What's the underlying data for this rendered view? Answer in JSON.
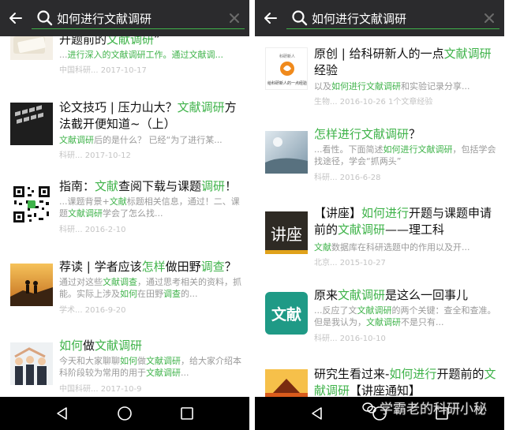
{
  "left": {
    "search": {
      "query": "如何进行文献调研"
    },
    "items": [
      {
        "title_parts": [
          [
            "开题前的",
            0
          ],
          [
            "文献调研",
            1
          ],
          [
            "”",
            0
          ]
        ],
        "snippet_parts": [
          [
            "...",
            0
          ],
          [
            "进行深入的文献调研工作。通过文献调...",
            1
          ]
        ],
        "meta": "中国科研...  2017-10-17"
      },
      {
        "title_parts": [
          [
            "论文技巧 | 压力山大？",
            0
          ],
          [
            "文献调研",
            1
          ],
          [
            "方法截开便知道~（上）",
            0
          ]
        ],
        "snippet_parts": [
          [
            "文献调研",
            1
          ],
          [
            "后的是什么？ 已经“为了进行某...",
            0
          ]
        ],
        "meta": "科研... 2017-10-12"
      },
      {
        "title_parts": [
          [
            "指南：",
            0
          ],
          [
            "文献",
            1
          ],
          [
            "查阅下载与课题",
            0
          ],
          [
            "调研",
            1
          ],
          [
            "！",
            0
          ]
        ],
        "snippet_parts": [
          [
            "...课题背景+",
            0
          ],
          [
            "文献",
            1
          ],
          [
            "标题相关信息，通过！二、课题",
            0
          ],
          [
            "文献调研",
            1
          ],
          [
            "学会了怎么找...",
            0
          ]
        ],
        "meta": "科研... 2016-2-10"
      },
      {
        "title_parts": [
          [
            "荐读 | 学者应该",
            0
          ],
          [
            "怎样",
            1
          ],
          [
            "做田野",
            0
          ],
          [
            "调查",
            1
          ],
          [
            "？",
            0
          ]
        ],
        "snippet_parts": [
          [
            "通过对这些",
            0
          ],
          [
            "文献调查",
            1
          ],
          [
            "，通过思考相关的资料，抓能。实际上涉及",
            0
          ],
          [
            "如何",
            1
          ],
          [
            "在田野",
            0
          ],
          [
            "调查",
            1
          ],
          [
            "的...",
            0
          ]
        ],
        "meta": "学术... 2016-9-20"
      },
      {
        "title_parts": [
          [
            "如何",
            1
          ],
          [
            "做",
            0
          ],
          [
            "文献调研",
            1
          ]
        ],
        "snippet_parts": [
          [
            "今天和大家聊聊",
            0
          ],
          [
            "如何",
            1
          ],
          [
            "做",
            0
          ],
          [
            "文献调研",
            1
          ],
          [
            "，给大家介绍本科阶段较为常用的用于",
            0
          ],
          [
            "文献调研",
            1
          ],
          [
            "...",
            0
          ]
        ],
        "meta": "中国科研... 2017-10-9"
      }
    ]
  },
  "right": {
    "search": {
      "query": "如何进行文献调研"
    },
    "items": [
      {
        "title_parts": [
          [
            "原创 | 给科研新人的一点",
            0
          ],
          [
            "文献调研",
            1
          ],
          [
            "经验",
            0
          ]
        ],
        "snippet_parts": [
          [
            "以及",
            0
          ],
          [
            "如何进行文献调研",
            1
          ],
          [
            "和实验记录分享...",
            0
          ]
        ],
        "meta": "生物... 2016-10-26    1个文章经验"
      },
      {
        "title_parts": [
          [
            "怎样进行文献调研",
            1
          ],
          [
            "？",
            0
          ]
        ],
        "snippet_parts": [
          [
            "...看性。下面简述",
            0
          ],
          [
            "如何进行文献调研",
            1
          ],
          [
            "，包括学会找途径，学会“抓两头”",
            0
          ]
        ],
        "meta": "科研... 2016-6-28"
      },
      {
        "title_parts": [
          [
            "【讲座】",
            0
          ],
          [
            "如何进行",
            1
          ],
          [
            "开题与课题申请前的",
            0
          ],
          [
            "文献调研",
            1
          ],
          [
            "——理工科",
            0
          ]
        ],
        "snippet_parts": [
          [
            "文献",
            1
          ],
          [
            "数据库在科研选题中的作用以及开...",
            0
          ]
        ],
        "meta": "北京... 2015-10-27"
      },
      {
        "title_parts": [
          [
            "原来",
            0
          ],
          [
            "文献调研",
            1
          ],
          [
            "是这么一回事儿",
            0
          ]
        ],
        "snippet_parts": [
          [
            "...反应了文",
            0
          ],
          [
            "文献调研",
            1
          ],
          [
            "的两个关键：查全和查准。但是我认为，",
            0
          ],
          [
            "文献调研",
            1
          ],
          [
            "不是只有...",
            0
          ]
        ],
        "meta": "科研... 2016-10-10"
      },
      {
        "title_parts": [
          [
            "研究生看过来-",
            0
          ],
          [
            "如何进行",
            1
          ],
          [
            "开题前的",
            0
          ],
          [
            "文献调研",
            1
          ],
          [
            "【讲座通知】",
            0
          ]
        ],
        "snippet_parts": [],
        "meta": ""
      }
    ],
    "thumb_labels": {
      "lecture": "讲座",
      "wenxian": "文献",
      "book_cover": "给科研新人的一点经验",
      "book_top": "科研新人"
    }
  },
  "watermark": "学霸老的科研小秘",
  "colors": {
    "accent": "#3fb34a",
    "topbar": "#2b2b2d",
    "navbar": "#000000"
  }
}
